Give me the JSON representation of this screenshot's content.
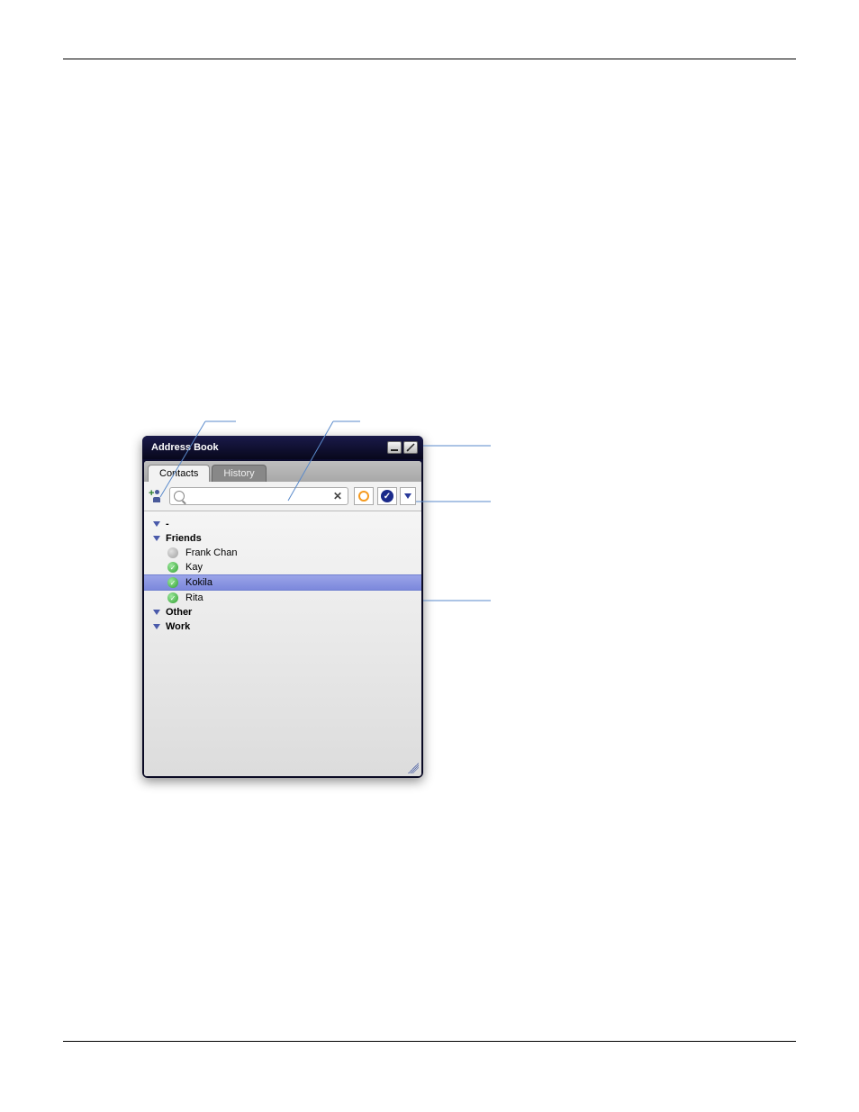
{
  "window": {
    "title": "Address Book",
    "tabs": [
      {
        "label": "Contacts",
        "active": true
      },
      {
        "label": "History",
        "active": false
      }
    ],
    "search": {
      "placeholder": "",
      "value": ""
    },
    "groups": [
      {
        "name": "-",
        "expanded": true,
        "contacts": []
      },
      {
        "name": "Friends",
        "expanded": true,
        "contacts": [
          {
            "name": "Frank Chan",
            "status": "offline",
            "selected": false
          },
          {
            "name": "Kay",
            "status": "online",
            "selected": false
          },
          {
            "name": "Kokila",
            "status": "online",
            "selected": true
          },
          {
            "name": "Rita",
            "status": "online",
            "selected": false
          }
        ]
      },
      {
        "name": "Other",
        "expanded": false,
        "contacts": []
      },
      {
        "name": "Work",
        "expanded": false,
        "contacts": []
      }
    ]
  }
}
